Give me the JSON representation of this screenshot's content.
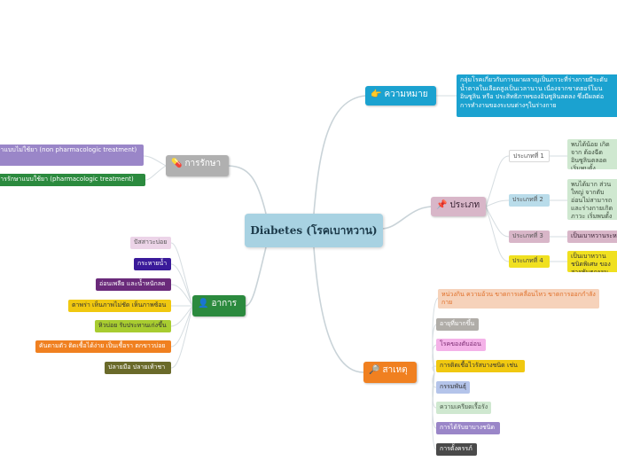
{
  "center": "Diabetes (โรคเบาหวาน)",
  "colors": {
    "line": "#c9d3d8",
    "definition": "#1ba2d0",
    "types": "#d8b6c8",
    "cause": "#f08020",
    "symptoms": "#2b8a3e",
    "treatment": "#b0b0b0"
  },
  "definition": {
    "title": "ความหมาย",
    "icon": "pointing-hand-icon",
    "text": "กลุ่มโรคเกี่ยวกับการเผาผลาญเป็นภาวะที่ร่างกายมีระดับน้ำตาลในเลือดสูงเป็นเวลานาน เนื่องจากขาดฮอร์โมนอินซูลิน หรือ ประสิทธิภาพของอินซูลินลดลง ซึ่งมีผลต่อการทำงานของระบบต่างๆในร่างกาย"
  },
  "types": {
    "title": "ประเภท",
    "icon": "pin-icon",
    "items": [
      {
        "label": "ประเภทที่ 1",
        "desc": "พบได้น้อย เกิดจาก ต้องฉีดอินซูลินตลอด เริ่มพบตั้ง"
      },
      {
        "label": "ประเภทที่ 2",
        "desc": "พบได้มาก ส่วนใหญ่ จากตับอ่อนไม่สามารถ และร่างกายเกิดภาวะ เริ่มพบตั้ง"
      },
      {
        "label": "ประเภทที่ 3",
        "desc": "เป็นเบาหวานระหว่าง"
      },
      {
        "label": "ประเภทที่ 4",
        "desc": "เป็นเบาหวานชนิดพิเศษ ของสารพันธุกรรม"
      }
    ]
  },
  "cause": {
    "title": "สาเหตุ",
    "icon": "magnifier-icon",
    "items": [
      "หน่วงกิน ความอ้วน ขาดการเคลื่อนไหว ขาดการออกกำลังกาย",
      "อายุที่มากขึ้น",
      "โรคของตับอ่อน",
      "การติดเชื้อไวรัสบางชนิด เช่น",
      "กรรมพันธุ์",
      "ความเครียดเรื้อรัง",
      "การได้รับยาบางชนิด",
      "การตั้งครรภ์"
    ]
  },
  "symptoms": {
    "title": "อาการ",
    "icon": "person-icon",
    "items": [
      "ปัสสาวะบ่อย",
      "กระหายน้ำ",
      "อ่อนเพลีย และน้ำหนักลด",
      "ตาพร่า เห็นภาพไม่ชัด เห็นภาพซ้อน",
      "หิวบ่อย รับประทานเก่งขึ้น",
      "คันตามตัว ติดเชื้อได้ง่าย เป็นเชื้อรา ตกขาวบ่อย",
      "ปลายมือ ปลายเท้าชา"
    ]
  },
  "treatment": {
    "title": "การรักษา",
    "icon": "pill-icon",
    "items": [
      "การรักษาแบบไม่ใช้ยา (non pharmacologic treatment)",
      "การรักษาแบบใช้ยา (pharmacologic treatment)"
    ]
  }
}
